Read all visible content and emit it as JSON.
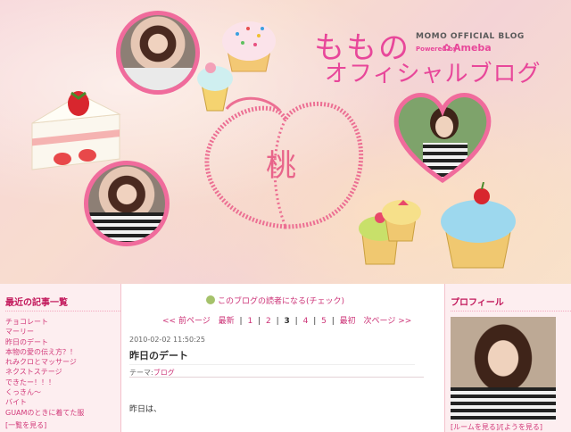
{
  "header": {
    "title_line1": "ももの",
    "title_line2": "オフィシャルブログ",
    "official_label": "MOMO OFFICIAL BLOG",
    "powered_label": "Powered by",
    "ameba_label": "Ameba",
    "peach_char": "桃"
  },
  "left": {
    "title": "最近の記事一覧",
    "articles": [
      "チョコレート",
      "マーリー",
      "昨日のデート",
      "本物の愛の伝え方？！",
      "れみクロとマッサージ",
      "ネクストステージ",
      "できたー！！！",
      "くっきん〜",
      "バイト",
      "GUAMのときに着てた服"
    ],
    "more": "[一覧を見る]"
  },
  "main": {
    "reader_link": "このブログの読者になる(チェック)",
    "pager": {
      "prev": "<< 前ページ",
      "latest": "最新",
      "pages": [
        "1",
        "2",
        "3",
        "4",
        "5"
      ],
      "current_page": "3",
      "first": "最初",
      "next": "次ページ >>"
    },
    "post": {
      "date": "2010-02-02 11:50:25",
      "title": "昨日のデート",
      "theme_label": "テーマ:",
      "theme": "ブログ",
      "body_start": "昨日は、"
    }
  },
  "right": {
    "title": "プロフィール",
    "link": "[ルームを見る]/[ようを見る]"
  },
  "colors": {
    "accent": "#e8479a",
    "link": "#cc3377",
    "sidebar_bg": "#fdeef0"
  }
}
